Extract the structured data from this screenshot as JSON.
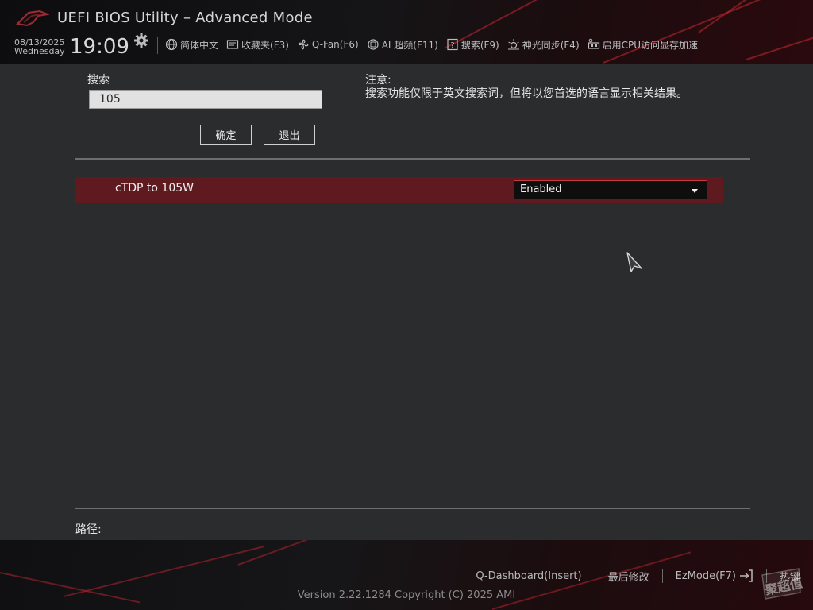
{
  "header": {
    "title": "UEFI BIOS Utility – Advanced Mode",
    "date": "08/13/2025",
    "day": "Wednesday",
    "time": "19:09",
    "toolbar": [
      {
        "label": "简体中文",
        "icon": "globe-icon"
      },
      {
        "label": "收藏夹(F3)",
        "icon": "favorites-icon"
      },
      {
        "label": "Q-Fan(F6)",
        "icon": "fan-icon"
      },
      {
        "label": "AI 超频(F11)",
        "icon": "ai-chip-icon"
      },
      {
        "label": "搜索(F9)",
        "icon": "search-help-icon"
      },
      {
        "label": "神光同步(F4)",
        "icon": "aura-light-icon"
      },
      {
        "label": "启用CPU访问显存加速",
        "icon": "resize-bar-icon"
      }
    ]
  },
  "search": {
    "label": "搜索",
    "value": "105",
    "confirm_label": "确定",
    "exit_label": "退出"
  },
  "note": {
    "title": "注意:",
    "body": "搜索功能仅限于英文搜索词，但将以您首选的语言显示相关结果。"
  },
  "results": [
    {
      "label": "cTDP to 105W",
      "value": "Enabled"
    }
  ],
  "path_label": "路径:",
  "footer": {
    "links": [
      "Q-Dashboard(Insert)",
      "最后修改",
      "EzMode(F7)",
      "热键"
    ],
    "version": "Version 2.22.1284 Copyright (C) 2025 AMI"
  },
  "watermark": "聚超值",
  "colors": {
    "accent_red": "#c33a43",
    "row_highlight": "#5e1a1f",
    "background": "#2a2c2e"
  }
}
